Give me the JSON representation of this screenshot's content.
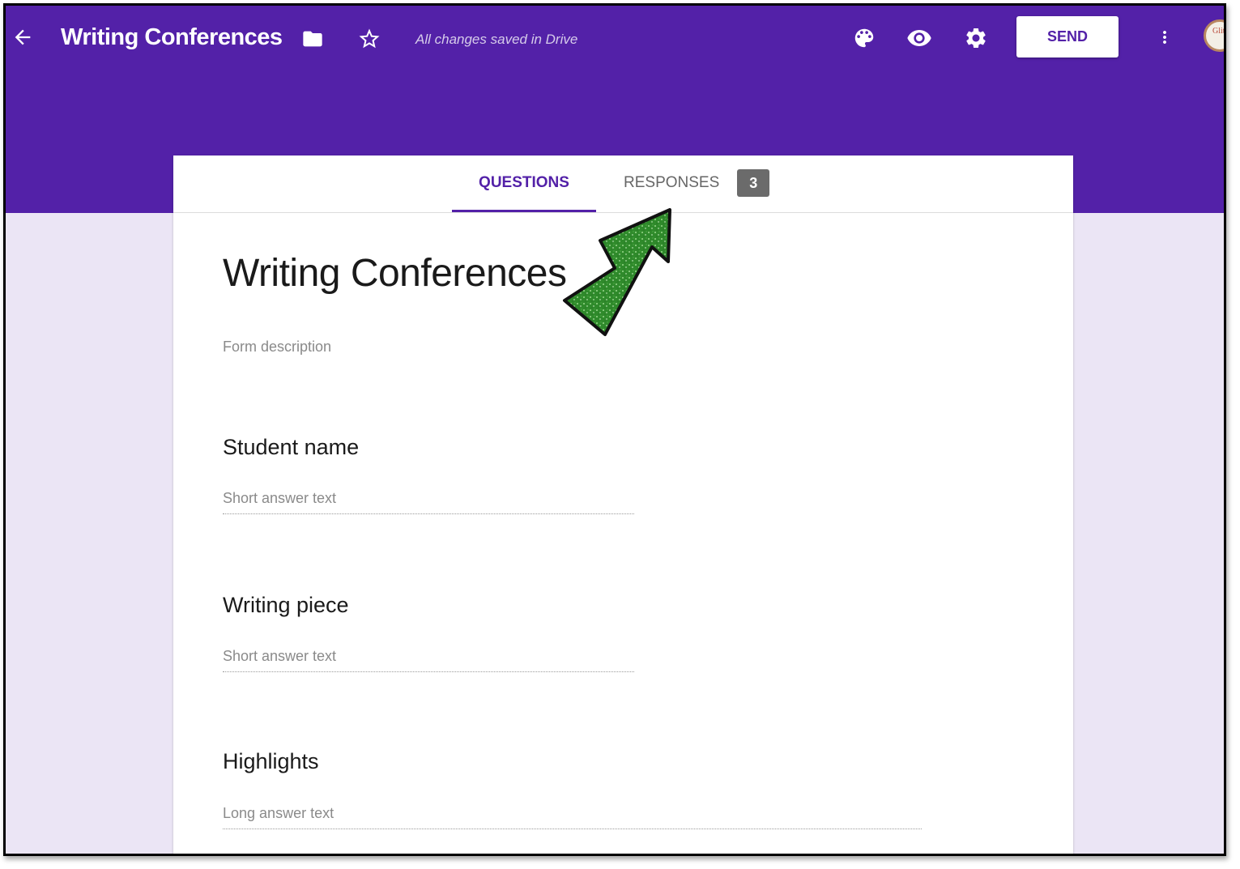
{
  "header": {
    "title": "Writing Conferences",
    "save_status": "All changes saved in Drive",
    "send_label": "SEND",
    "avatar_text": "Glit",
    "icons": [
      "back-arrow-icon",
      "folder-icon",
      "star-icon",
      "palette-icon",
      "eye-icon",
      "gear-icon",
      "more-vert-icon"
    ]
  },
  "tabs": {
    "questions_label": "QUESTIONS",
    "responses_label": "RESPONSES",
    "responses_count": "3"
  },
  "form": {
    "title": "Writing Conferences",
    "description_placeholder": "Form description",
    "questions": [
      {
        "label": "Student name",
        "answer_placeholder": "Short answer text"
      },
      {
        "label": "Writing piece",
        "answer_placeholder": "Short answer text"
      },
      {
        "label": "Highlights",
        "answer_placeholder": "Long answer text"
      }
    ]
  },
  "colors": {
    "brand_purple": "#5321a8",
    "background_lavender": "#ebe5f5",
    "annotation_arrow": "#2e8b2e"
  }
}
